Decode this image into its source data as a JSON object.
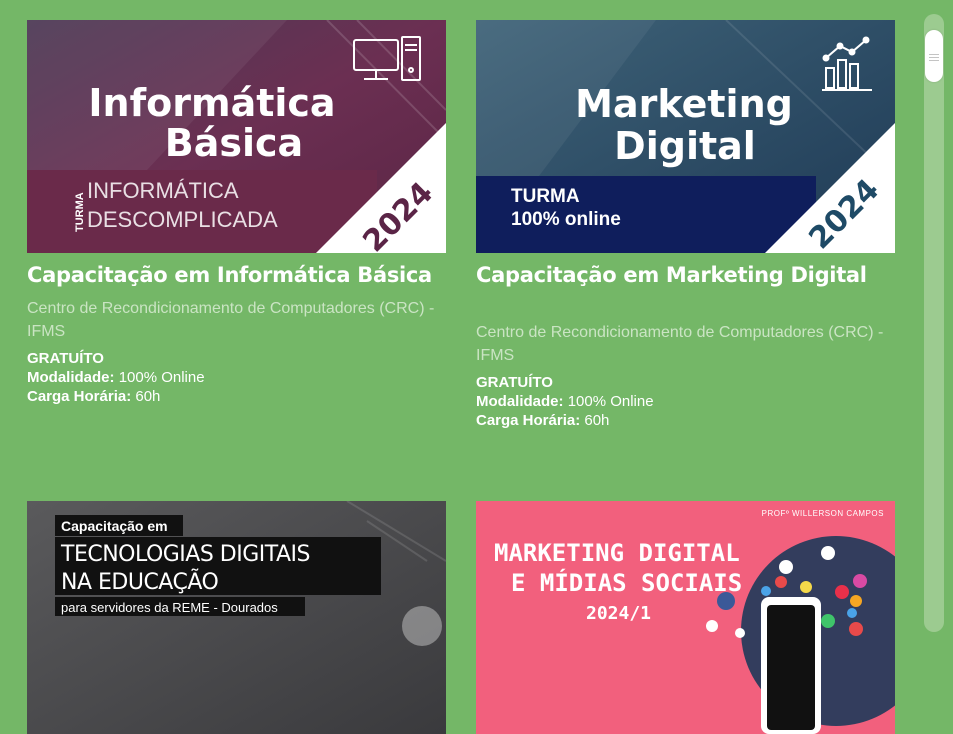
{
  "courses": [
    {
      "banner": {
        "heading_line1": "Informática",
        "heading_line2": "Básica",
        "turma_label": "TURMA",
        "subtitle_line1": "INFORMÁTICA",
        "subtitle_line2": "DESCOMPLICADA",
        "year": "2024",
        "icon": "computer-icon"
      },
      "title": "Capacitação em Informática Básica",
      "org": "Centro de Recondicionamento de Computadores (CRC) - IFMS",
      "price": "GRATUÍTO",
      "modality_label": "Modalidade:",
      "modality_value": "100% Online",
      "workload_label": "Carga Horária:",
      "workload_value": "60h"
    },
    {
      "banner": {
        "heading_line1": "Marketing",
        "heading_line2": "Digital",
        "turma_line1": "TURMA",
        "turma_line2": "100% online",
        "year": "2024",
        "icon": "bar-chart-icon"
      },
      "title": "Capacitação em Marketing Digital",
      "org": "Centro de Recondicionamento de Computadores (CRC) - IFMS",
      "price": "GRATUÍTO",
      "modality_label": "Modalidade:",
      "modality_value": "100% Online",
      "workload_label": "Carga Horária:",
      "workload_value": "60h"
    },
    {
      "banner": {
        "kicker": "Capacitação em",
        "heading_line1": "TECNOLOGIAS DIGITAIS",
        "heading_line2": "NA EDUCAÇÃO",
        "subtitle": "para servidores da REME - Dourados"
      }
    },
    {
      "banner": {
        "author": "PROFº WILLERSON CAMPOS",
        "heading_line1": "MARKETING DIGITAL",
        "heading_line2": "E MÍDIAS SOCIAIS",
        "semester": "2024/1"
      }
    }
  ],
  "colors": {
    "page_bg": "#74b767",
    "banner1_bg": "#5e2a48",
    "banner2_bg": "#2e4f68",
    "banner2_band": "#0f1e5c",
    "banner4_bg": "#f2607d"
  }
}
